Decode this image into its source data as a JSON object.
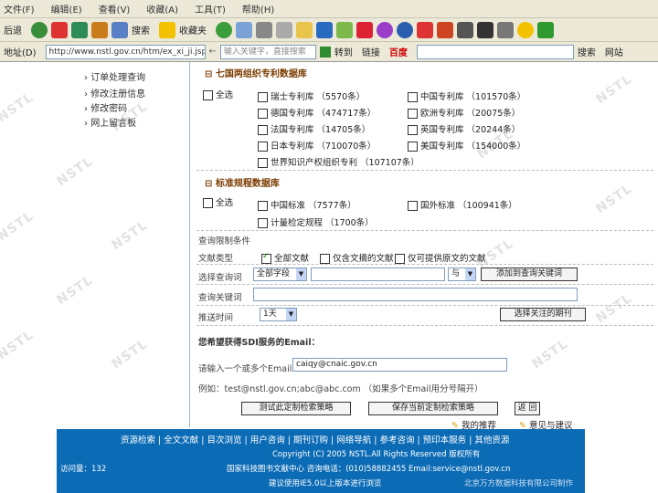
{
  "menubar": {
    "items": [
      "文件(F)",
      "编辑(E)",
      "查看(V)",
      "收藏(A)",
      "工具(T)",
      "帮助(H)"
    ]
  },
  "toolbar": {
    "back": "后退",
    "search": "搜索",
    "favorites": "收藏夹"
  },
  "addressbar": {
    "label": "地址(D)",
    "url": "http://www.nstl.gov.cn/htm/ex_xi_ji.jsp",
    "search_placeholder": "输入关键字，直接搜索",
    "go": "转到",
    "links": "链接",
    "baidu": "百度",
    "search_btn": "搜索",
    "right_label": "网站"
  },
  "leftnav": {
    "items": [
      "订单处理查询",
      "修改注册信息",
      "修改密码",
      "网上留言板"
    ]
  },
  "section1": {
    "title": "七国两组织专利数据库",
    "select_all": "全选",
    "items_left": [
      "瑞士专利库 （5570条）",
      "德国专利库 （474717条）",
      "法国专利库 （14705条）",
      "日本专利库 （710070条）",
      "世界知识产权组织专利 （107107条）"
    ],
    "items_right": [
      "中国专利库 （101570条）",
      "欧洲专利库 （20075条）",
      "英国专利库 （20244条）",
      "美国专利库 （154000条）"
    ]
  },
  "section2": {
    "title": "标准规程数据库",
    "select_all": "全选",
    "items_left": [
      "中国标准 （7577条）",
      "计量检定规程 （1700条）"
    ],
    "items_right": [
      "国外标准 （100941条）"
    ]
  },
  "form": {
    "conditions_label": "查询限制条件",
    "doc_type_label": "文献类型",
    "doc_types": [
      "全部文献",
      "仅含文摘的文献",
      "仅可提供原文的文献"
    ],
    "query_label": "选择查询词",
    "field_select": "全部字段",
    "logic_select": "与",
    "add_button": "添加到查询关键词",
    "keywords_label": "查询关键词",
    "freq_label": "推送时间",
    "freq_select": "1天",
    "journal_button": "选择关注的期刊",
    "sdi_title": "您希望获得SDI服务的Email：",
    "email_label": "请输入一个或多个Email",
    "email_value": "caiqy@cnaic.gov.cn",
    "email_example": "例如：test@nstl.gov.cn;abc@abc.com  （如果多个Email用分号隔开）",
    "btn_test": "测试此定制检索策略",
    "btn_save": "保存当前定制检索策略",
    "btn_back": "返 回",
    "recommend": "我的推荐",
    "suggest": "意见与建议"
  },
  "footer": {
    "links": "资源检索 | 全文文献 | 目次浏览 | 用户咨询 | 期刊订购 | 网络导航 | 参考咨询 | 预印本服务 | 其他资源",
    "copyright": "Copyright (C) 2005 NSTL.All Rights Reserved 版权所有",
    "contact": "国家科技图书文献中心 咨询电话：(010)58882455 Email:service@nstl.gov.cn",
    "visits": "访问量：132",
    "note": "建议使用IE5.0以上版本进行浏览",
    "org": "北京万方数据科技有限公司制作"
  }
}
